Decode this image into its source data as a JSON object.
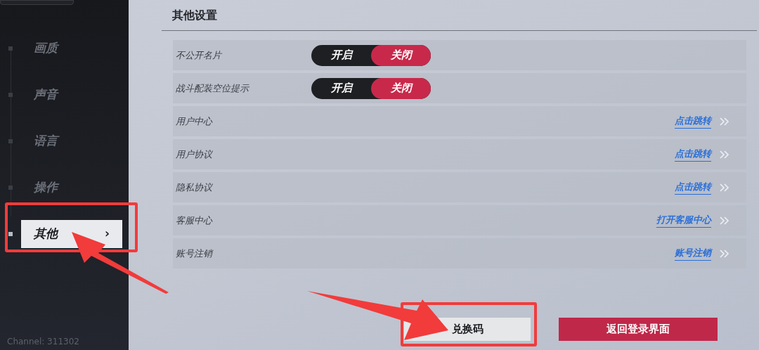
{
  "sidebar": {
    "items": [
      {
        "label": "画质",
        "selected": false
      },
      {
        "label": "声音",
        "selected": false
      },
      {
        "label": "语言",
        "selected": false
      },
      {
        "label": "操作",
        "selected": false
      },
      {
        "label": "其他",
        "selected": true,
        "chevron": "›"
      }
    ],
    "channel": "Channel: 311302"
  },
  "section": {
    "title": "其他设置"
  },
  "rows": [
    {
      "kind": "toggle",
      "label": "不公开名片",
      "options": [
        {
          "label": "开启",
          "selected": false
        },
        {
          "label": "关闭",
          "selected": true
        }
      ]
    },
    {
      "kind": "toggle",
      "label": "战斗配装空位提示",
      "options": [
        {
          "label": "开启",
          "selected": false
        },
        {
          "label": "关闭",
          "selected": true
        }
      ]
    },
    {
      "kind": "link",
      "label": "用户中心",
      "link": "点击跳转"
    },
    {
      "kind": "link",
      "label": "用户协议",
      "link": "点击跳转"
    },
    {
      "kind": "link",
      "label": "隐私协议",
      "link": "点击跳转"
    },
    {
      "kind": "link",
      "label": "客服中心",
      "link": "打开客服中心"
    },
    {
      "kind": "link",
      "label": "账号注销",
      "link": "账号注销"
    }
  ],
  "buttons": [
    {
      "label": "兑换码",
      "kind": "secondary"
    },
    {
      "label": "返回登录界面",
      "kind": "primary"
    }
  ]
}
